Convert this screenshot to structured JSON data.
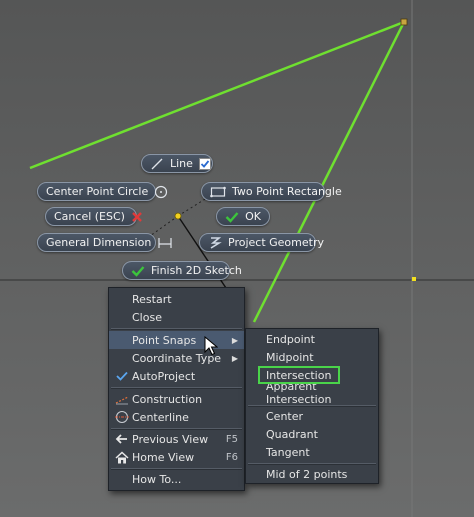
{
  "colors": {
    "sketch_line": "#6fe030",
    "menu_bg": "#3a4048",
    "pill_bg": "#434d5a",
    "highlight": "#4a5a70",
    "green_box": "#4ad44a",
    "check": "#3cc43c",
    "red_x": "#e03a3a"
  },
  "marking_menu": {
    "line": {
      "label": "Line",
      "icon": "line-icon",
      "check": "check-icon"
    },
    "center_point_circle": {
      "label": "Center Point Circle",
      "icon": "circle-icon"
    },
    "two_point_rectangle": {
      "label": "Two Point Rectangle",
      "icon": "rectangle-icon"
    },
    "cancel": {
      "label": "Cancel (ESC)",
      "icon": "x-icon"
    },
    "ok": {
      "label": "OK",
      "icon": "check-icon"
    },
    "general_dimension": {
      "label": "General Dimension",
      "icon": "dimension-icon"
    },
    "project_geometry": {
      "label": "Project Geometry",
      "icon": "project-geometry-icon"
    },
    "finish_2d_sketch": {
      "label": "Finish 2D Sketch",
      "icon": "check-icon"
    }
  },
  "context_menu": {
    "restart": "Restart",
    "close": "Close",
    "point_snaps": "Point Snaps",
    "coordinate_type": "Coordinate Type",
    "autoproject": "AutoProject",
    "construction": "Construction",
    "centerline": "Centerline",
    "previous_view": {
      "label": "Previous View",
      "shortcut": "F5"
    },
    "home_view": {
      "label": "Home View",
      "shortcut": "F6"
    },
    "how_to": "How To..."
  },
  "point_snaps_menu": {
    "endpoint": "Endpoint",
    "midpoint": "Midpoint",
    "intersection": "Intersection",
    "apparent_intersection": "Apparent Intersection",
    "center": "Center",
    "quadrant": "Quadrant",
    "tangent": "Tangent",
    "mid_of_2_points": "Mid of 2 points"
  }
}
